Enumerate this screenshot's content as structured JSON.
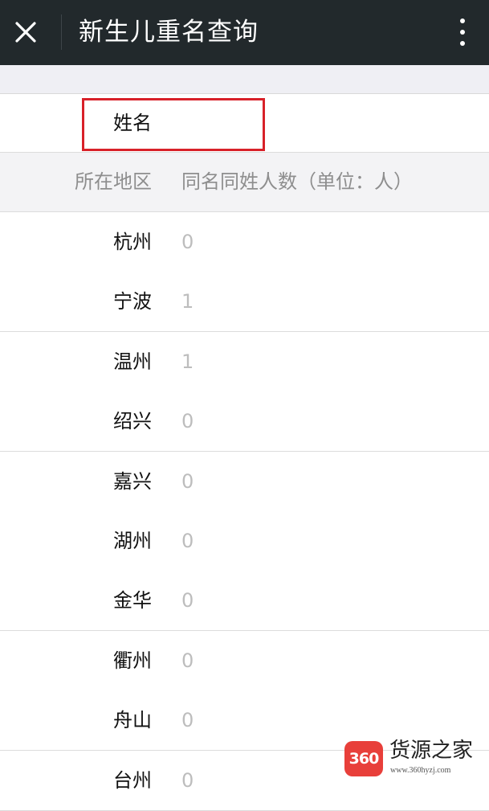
{
  "topbar": {
    "title": "新生儿重名查询",
    "close_icon": "close-icon",
    "menu_icon": "more-vertical-icon",
    "background": "#22292c"
  },
  "name_row": {
    "label": "姓名",
    "value": "",
    "highlight_color": "#d82129"
  },
  "table": {
    "headers": [
      "所在地区",
      "同名同姓人数（单位：人）"
    ],
    "rows": [
      {
        "region": "杭州",
        "count": "0"
      },
      {
        "region": "宁波",
        "count": "1"
      },
      {
        "region": "温州",
        "count": "1"
      },
      {
        "region": "绍兴",
        "count": "0"
      },
      {
        "region": "嘉兴",
        "count": "0"
      },
      {
        "region": "湖州",
        "count": "0"
      },
      {
        "region": "金华",
        "count": "0"
      },
      {
        "region": "衢州",
        "count": "0"
      },
      {
        "region": "舟山",
        "count": "0"
      },
      {
        "region": "台州",
        "count": "0"
      }
    ]
  },
  "watermark": {
    "badge": "360",
    "name": "货源之家",
    "url": "www.360hyzj.com"
  }
}
